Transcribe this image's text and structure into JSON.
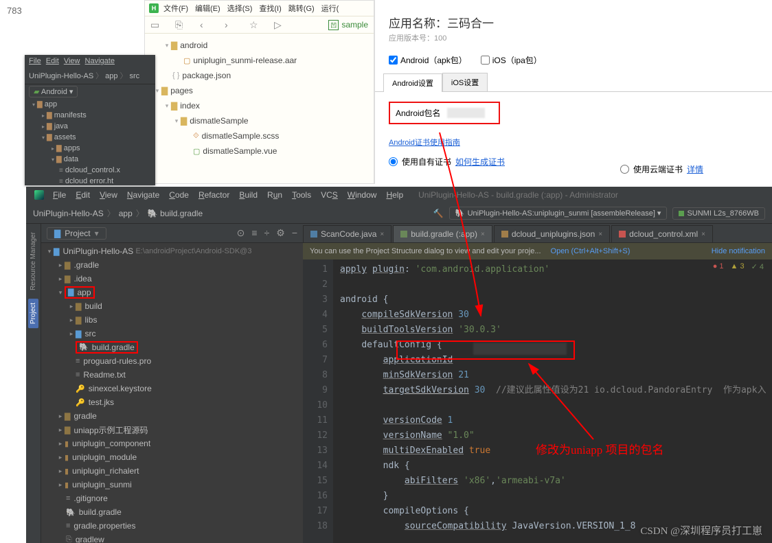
{
  "corner": "783",
  "hbx": {
    "menu": [
      "文件(F)",
      "编辑(E)",
      "选择(S)",
      "查找(I)",
      "跳转(G)",
      "运行("
    ],
    "tab": "sample",
    "tree": {
      "android": "android",
      "aar": "uniplugin_sunmi-release.aar",
      "pkg": "package.json",
      "pages": "pages",
      "index": "index",
      "dismatleSample": "dismatleSample",
      "scss": "dismatleSample.scss",
      "vue": "dismatleSample.vue"
    }
  },
  "uni": {
    "title": "应用名称：三码合一",
    "sub": "应用版本号：100",
    "check_android": "Android（apk包）",
    "check_ios": "iOS（ipa包）",
    "tab_android": "Android设置",
    "tab_ios": "iOS设置",
    "pkg_label": "Android包名",
    "cert_link": "Android证书使用指南",
    "radio1": "使用自有证书",
    "radio1_link": "如何生成证书",
    "radio2": "使用云端证书",
    "radio2_link": "详情"
  },
  "mini": {
    "menu": [
      "File",
      "Edit",
      "View",
      "Navigate"
    ],
    "crumb": [
      "UniPlugin-Hello-AS",
      "app",
      "src"
    ],
    "drop": "Android",
    "tree": [
      "app",
      "manifests",
      "java",
      "assets",
      "apps",
      "data",
      "dcloud_control.x",
      "dcloud error.ht"
    ],
    "side": "Resource Manager"
  },
  "ide": {
    "menu": [
      "File",
      "Edit",
      "View",
      "Navigate",
      "Code",
      "Refactor",
      "Build",
      "Run",
      "Tools",
      "VCS",
      "Window",
      "Help"
    ],
    "title_tail": "UniPlugin-Hello-AS - build.gradle (:app) - Administrator",
    "crumb": {
      "p": "UniPlugin-Hello-AS",
      "a": "app",
      "g": "build.gradle"
    },
    "run_config": "UniPlugin-Hello-AS:uniplugin_sunmi [assembleRelease]",
    "device": "SUNMI L2s_8766WB",
    "pane_selector": "Project",
    "sidebar_tabs": [
      "Resource Manager",
      "Project"
    ],
    "tabs": [
      {
        "label": "ScanCode.java",
        "type": "java"
      },
      {
        "label": "build.gradle (:app)",
        "type": "gradle",
        "active": true
      },
      {
        "label": "dcloud_uniplugins.json",
        "type": "json"
      },
      {
        "label": "dcloud_control.xml",
        "type": "xml"
      }
    ],
    "banner": {
      "msg": "You can use the Project Structure dialog to view and edit your proje...",
      "open": "Open (Ctrl+Alt+Shift+S)",
      "hide": "Hide notification"
    },
    "status": {
      "err": "1",
      "warn": "3",
      "ok": "4"
    },
    "tree": {
      "root": "UniPlugin-Hello-AS",
      "rootPath": "E:\\androidProject\\Android-SDK@3",
      "gradleDir": ".gradle",
      "idea": ".idea",
      "app": "app",
      "build": "build",
      "libs": "libs",
      "src": "src",
      "buildGradle": "build.gradle",
      "proguard": "proguard-rules.pro",
      "readme": "Readme.txt",
      "keystore": "sinexcel.keystore",
      "testjks": "test.jks",
      "gradle": "gradle",
      "uniappSample": "uniapp示例工程源码",
      "uc": "uniplugin_component",
      "um": "uniplugin_module",
      "ur": "uniplugin_richalert",
      "us": "uniplugin_sunmi",
      "gitignore": ".gitignore",
      "rootBuild": "build.gradle",
      "gradleProps": "gradle.properties",
      "gradlew": "gradlew"
    },
    "code": {
      "l1_a": "apply",
      "l1_b": "plugin",
      "l1_c": "'com.android.application'",
      "l3": "android {",
      "l4_a": "compileSdkVersion",
      "l4_b": "30",
      "l5_a": "buildToolsVersion",
      "l5_b": "'30.0.3'",
      "l6": "defaultConfig {",
      "l7": "applicationId",
      "l8_a": "minSdkVersion",
      "l8_b": "21",
      "l9_a": "targetSdkVersion",
      "l9_b": "30",
      "l9_c": "//建议此属性值设为21 io.dcloud.PandoraEntry  作为apk入",
      "l11_a": "versionCode",
      "l11_b": "1",
      "l12_a": "versionName",
      "l12_b": "\"1.0\"",
      "l13_a": "multiDexEnabled",
      "l13_b": "true",
      "l14": "ndk {",
      "l15_a": "abiFilters",
      "l15_b": "'x86'",
      "l15_c": "'armeabi-v7a'",
      "l16": "}",
      "l17": "compileOptions {",
      "l18_a": "sourceCompatibility",
      "l18_b": "JavaVersion.VERSION_1_8"
    }
  },
  "annotation": "修改为uniapp 项目的包名",
  "watermark": "CSDN @深圳程序员打工崽"
}
